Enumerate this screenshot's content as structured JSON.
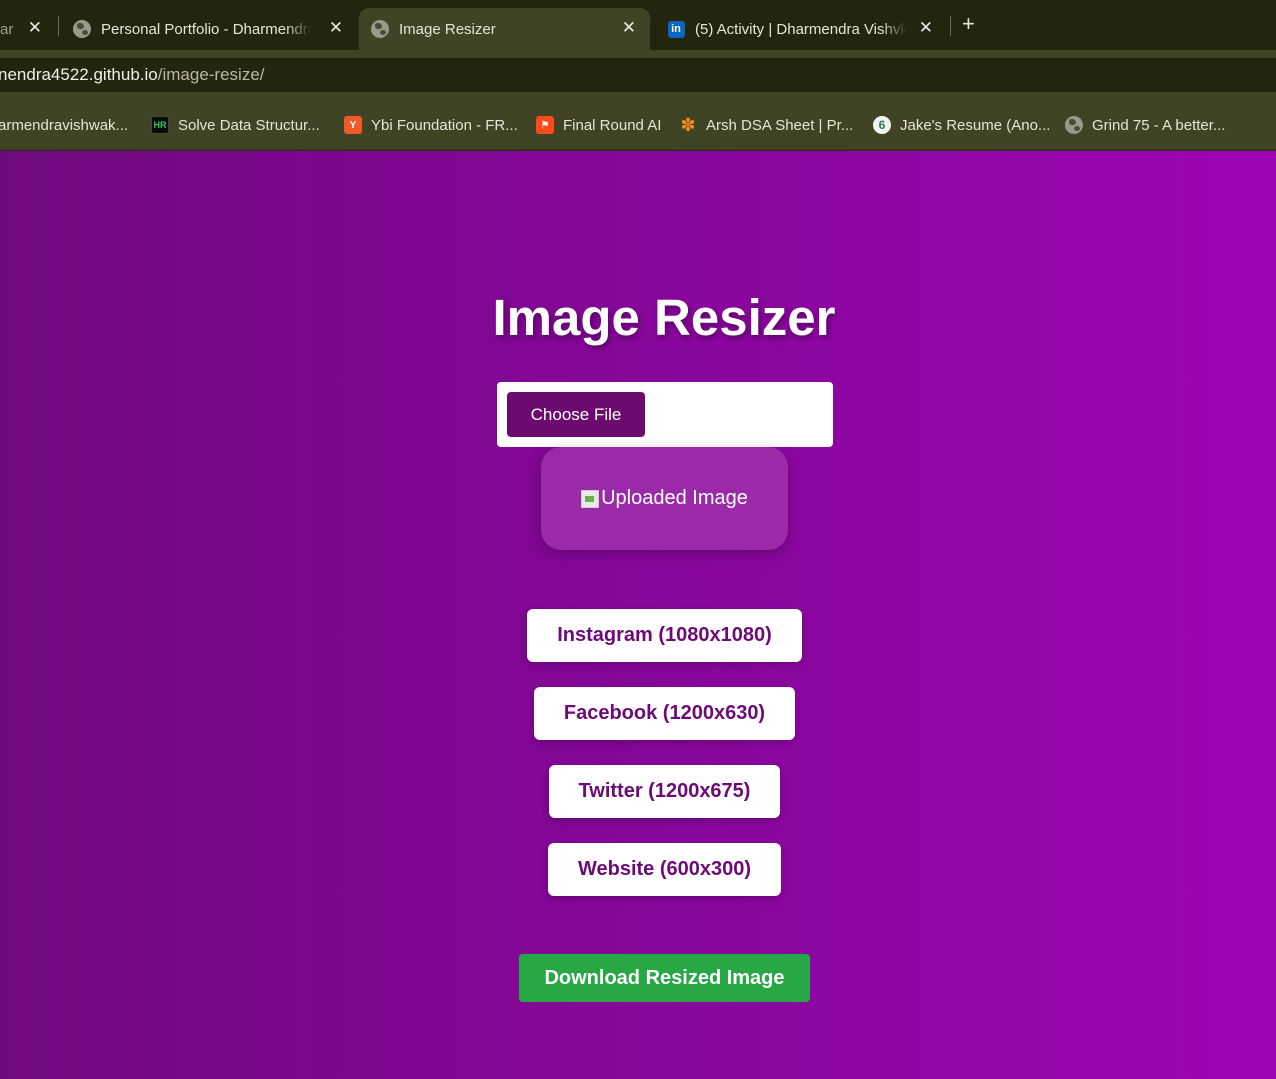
{
  "browser": {
    "tabs": [
      {
        "title": "ar",
        "favicon": "globe-icon",
        "active": false
      },
      {
        "title": "Personal Portfolio - Dharmendra",
        "favicon": "globe-icon",
        "active": false
      },
      {
        "title": "Image Resizer",
        "favicon": "globe-icon",
        "active": true
      },
      {
        "title": "(5) Activity | Dharmendra Vishvk",
        "favicon": "linkedin-icon",
        "active": false
      }
    ],
    "close_glyph": "✕",
    "new_tab_glyph": "+",
    "address": {
      "host": "nendra4522.github.io",
      "path": "/image-resize/"
    },
    "bookmarks": [
      {
        "label": "armendravishwak...",
        "icon": "none"
      },
      {
        "label": "Solve Data Structur...",
        "icon": "hackerrank-icon",
        "icon_text": "HR"
      },
      {
        "label": "Ybi Foundation - FR...",
        "icon": "ybi-icon",
        "icon_text": "Y"
      },
      {
        "label": "Final Round AI",
        "icon": "final-round-icon",
        "icon_text": "⚑"
      },
      {
        "label": "Arsh DSA Sheet | Pr...",
        "icon": "arsh-icon",
        "icon_text": "✽"
      },
      {
        "label": "Jake's Resume (Ano...",
        "icon": "overleaf-icon",
        "icon_text": "6"
      },
      {
        "label": "Grind 75 - A better...",
        "icon": "globe-icon",
        "icon_text": ""
      }
    ]
  },
  "app": {
    "title": "Image Resizer",
    "choose_file_label": "Choose File",
    "preview_alt": "Uploaded Image",
    "presets": [
      {
        "label": "Instagram (1080x1080)"
      },
      {
        "label": "Facebook (1200x630)"
      },
      {
        "label": "Twitter (1200x675)"
      },
      {
        "label": "Website (600x300)"
      }
    ],
    "download_label": "Download Resized Image"
  },
  "colors": {
    "page_gradient_start": "#6f0a7d",
    "page_gradient_end": "#9d05b4",
    "choose_button": "#6c0a70",
    "preset_text": "#6e0a78",
    "download_button": "#28a745"
  }
}
